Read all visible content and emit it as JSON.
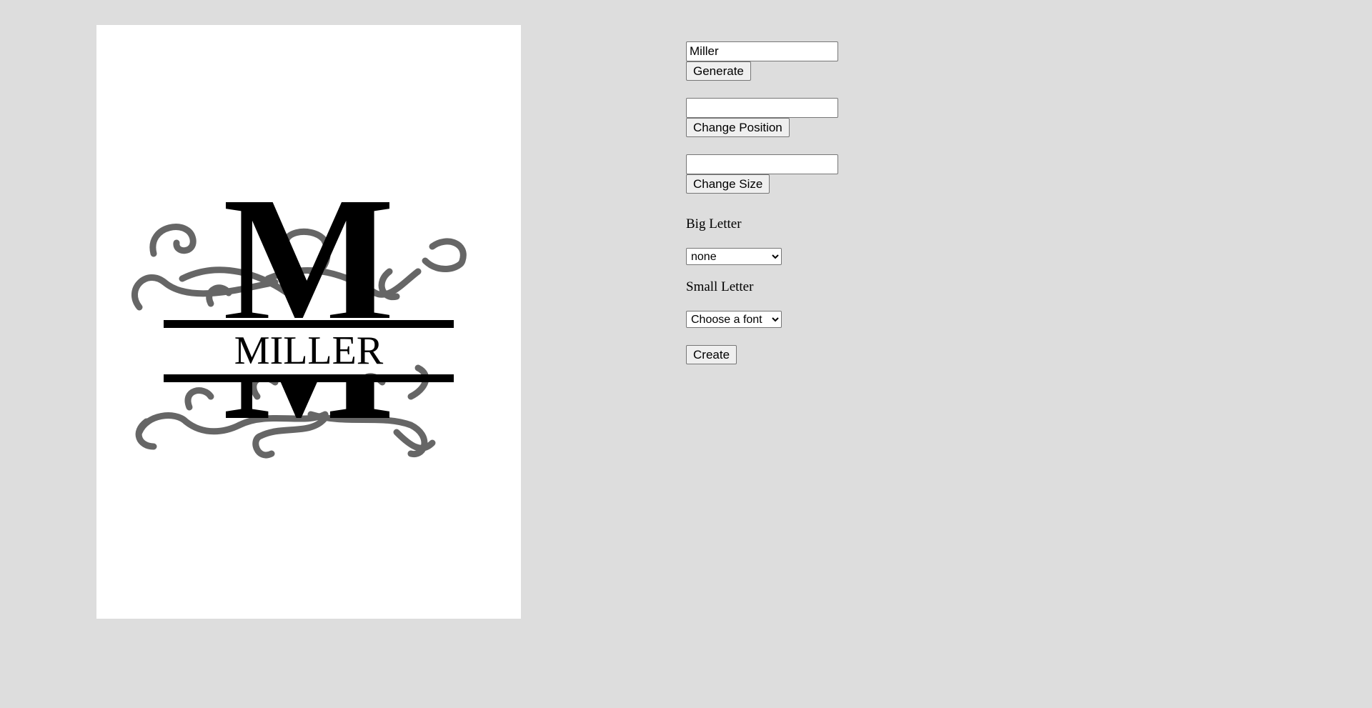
{
  "preview": {
    "name_text": "MILLER",
    "big_letter": "M"
  },
  "controls": {
    "name_input_value": "Miller",
    "generate_label": "Generate",
    "position_input_value": "",
    "change_position_label": "Change Position",
    "size_input_value": "",
    "change_size_label": "Change Size",
    "big_letter_label": "Big Letter",
    "big_letter_selected": "none",
    "small_letter_label": "Small Letter",
    "small_letter_selected": "Choose a font",
    "create_label": "Create"
  },
  "colors": {
    "background": "#dddddd",
    "canvas": "#ffffff",
    "swirl": "#666666",
    "ink": "#000000"
  }
}
